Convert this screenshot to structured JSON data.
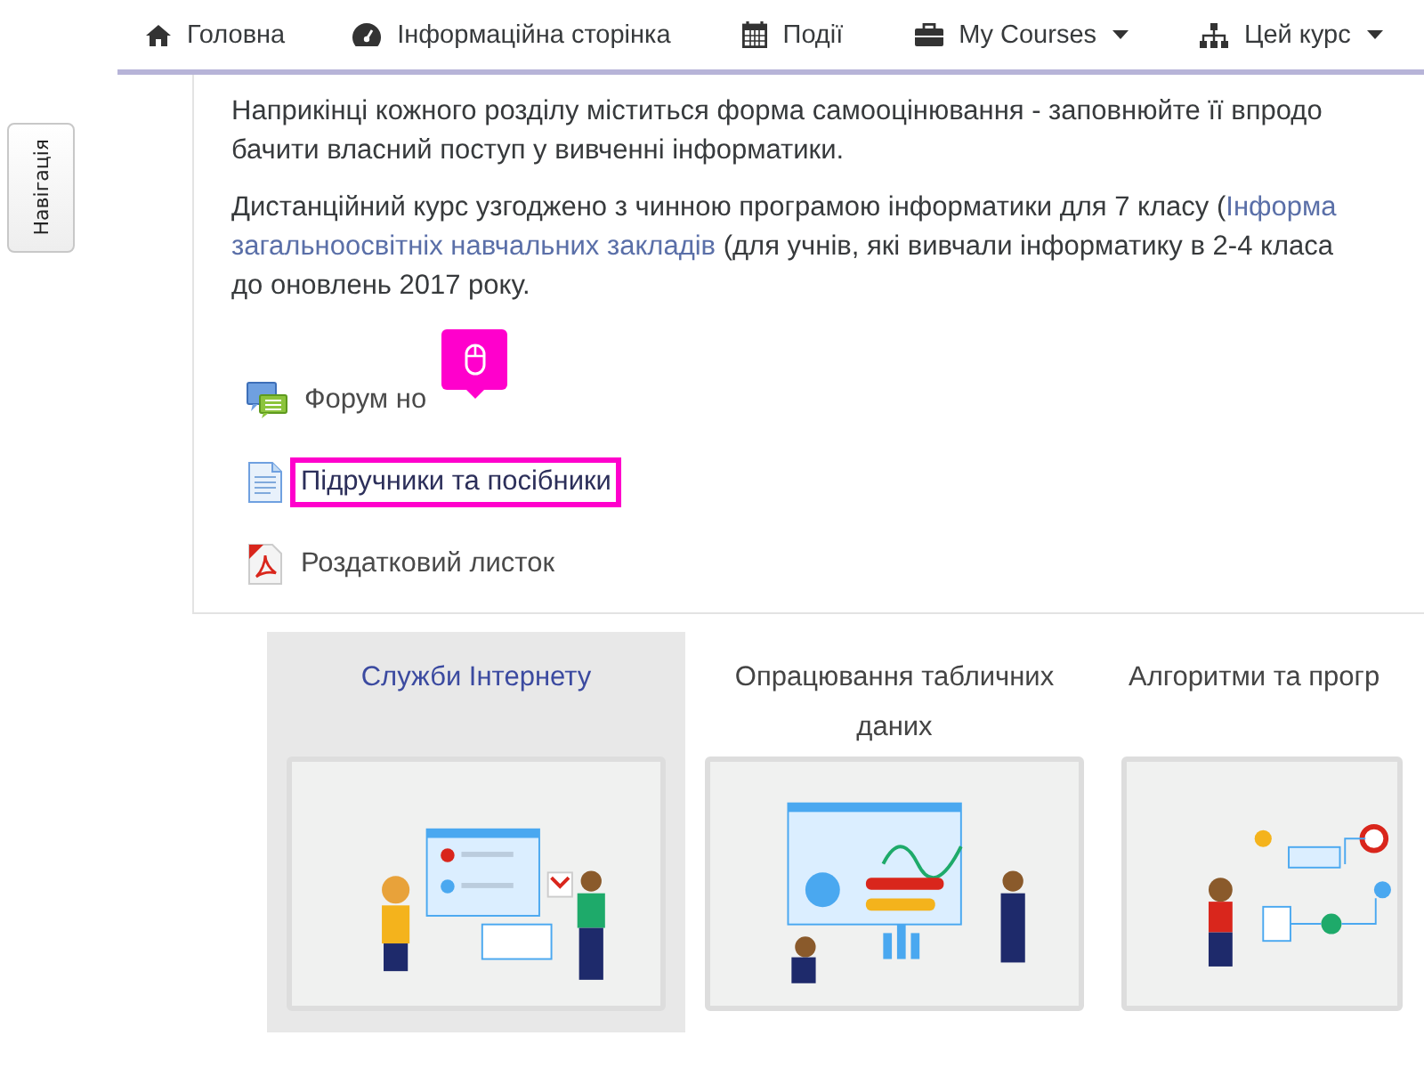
{
  "side_tab": {
    "label": "Навігація"
  },
  "nav": [
    {
      "kind": "home",
      "label": "Головна",
      "dropdown": false
    },
    {
      "kind": "dashboard",
      "label": "Інформаційна сторінка",
      "dropdown": false
    },
    {
      "kind": "calendar",
      "label": "Події",
      "dropdown": false
    },
    {
      "kind": "courses",
      "label": "My Courses",
      "dropdown": true
    },
    {
      "kind": "course",
      "label": "Цей курс",
      "dropdown": true
    }
  ],
  "paragraphs": [
    {
      "lines": [
        [
          {
            "kind": "text",
            "text": "Наприкінці кожного розділу міститься форма самооцінювання - заповнюйте її впродо"
          }
        ],
        [
          {
            "kind": "text",
            "text": "бачити власний поступ у вивченні інформатики."
          }
        ]
      ]
    },
    {
      "lines": [
        [
          {
            "kind": "text",
            "text": "Дистанційний курс узгоджено з чинною програмою інформатики для 7 класу ("
          },
          {
            "kind": "link",
            "text": "Інформа"
          }
        ],
        [
          {
            "kind": "link",
            "text": "загальноосвітніх навчальних закладів"
          },
          {
            "kind": "text",
            "text": " (для учнів, які вивчали інформатику в 2-4 класа"
          }
        ],
        [
          {
            "kind": "text",
            "text": "до оновлень 2017 року."
          }
        ]
      ]
    }
  ],
  "resources": [
    {
      "kind": "forum",
      "label": "Форум но",
      "highlighted": false,
      "tooltip": true
    },
    {
      "kind": "page",
      "label": "Підручники та посібники",
      "highlighted": true,
      "tooltip": false
    },
    {
      "kind": "pdf",
      "label": "Роздатковий листок",
      "highlighted": false,
      "tooltip": false
    }
  ],
  "courses": [
    {
      "title": "Служби Інтернету",
      "selected": true
    },
    {
      "title": "Опрацювання табличних даних",
      "selected": false
    },
    {
      "title": "Алгоритми та прогр",
      "selected": false
    }
  ]
}
